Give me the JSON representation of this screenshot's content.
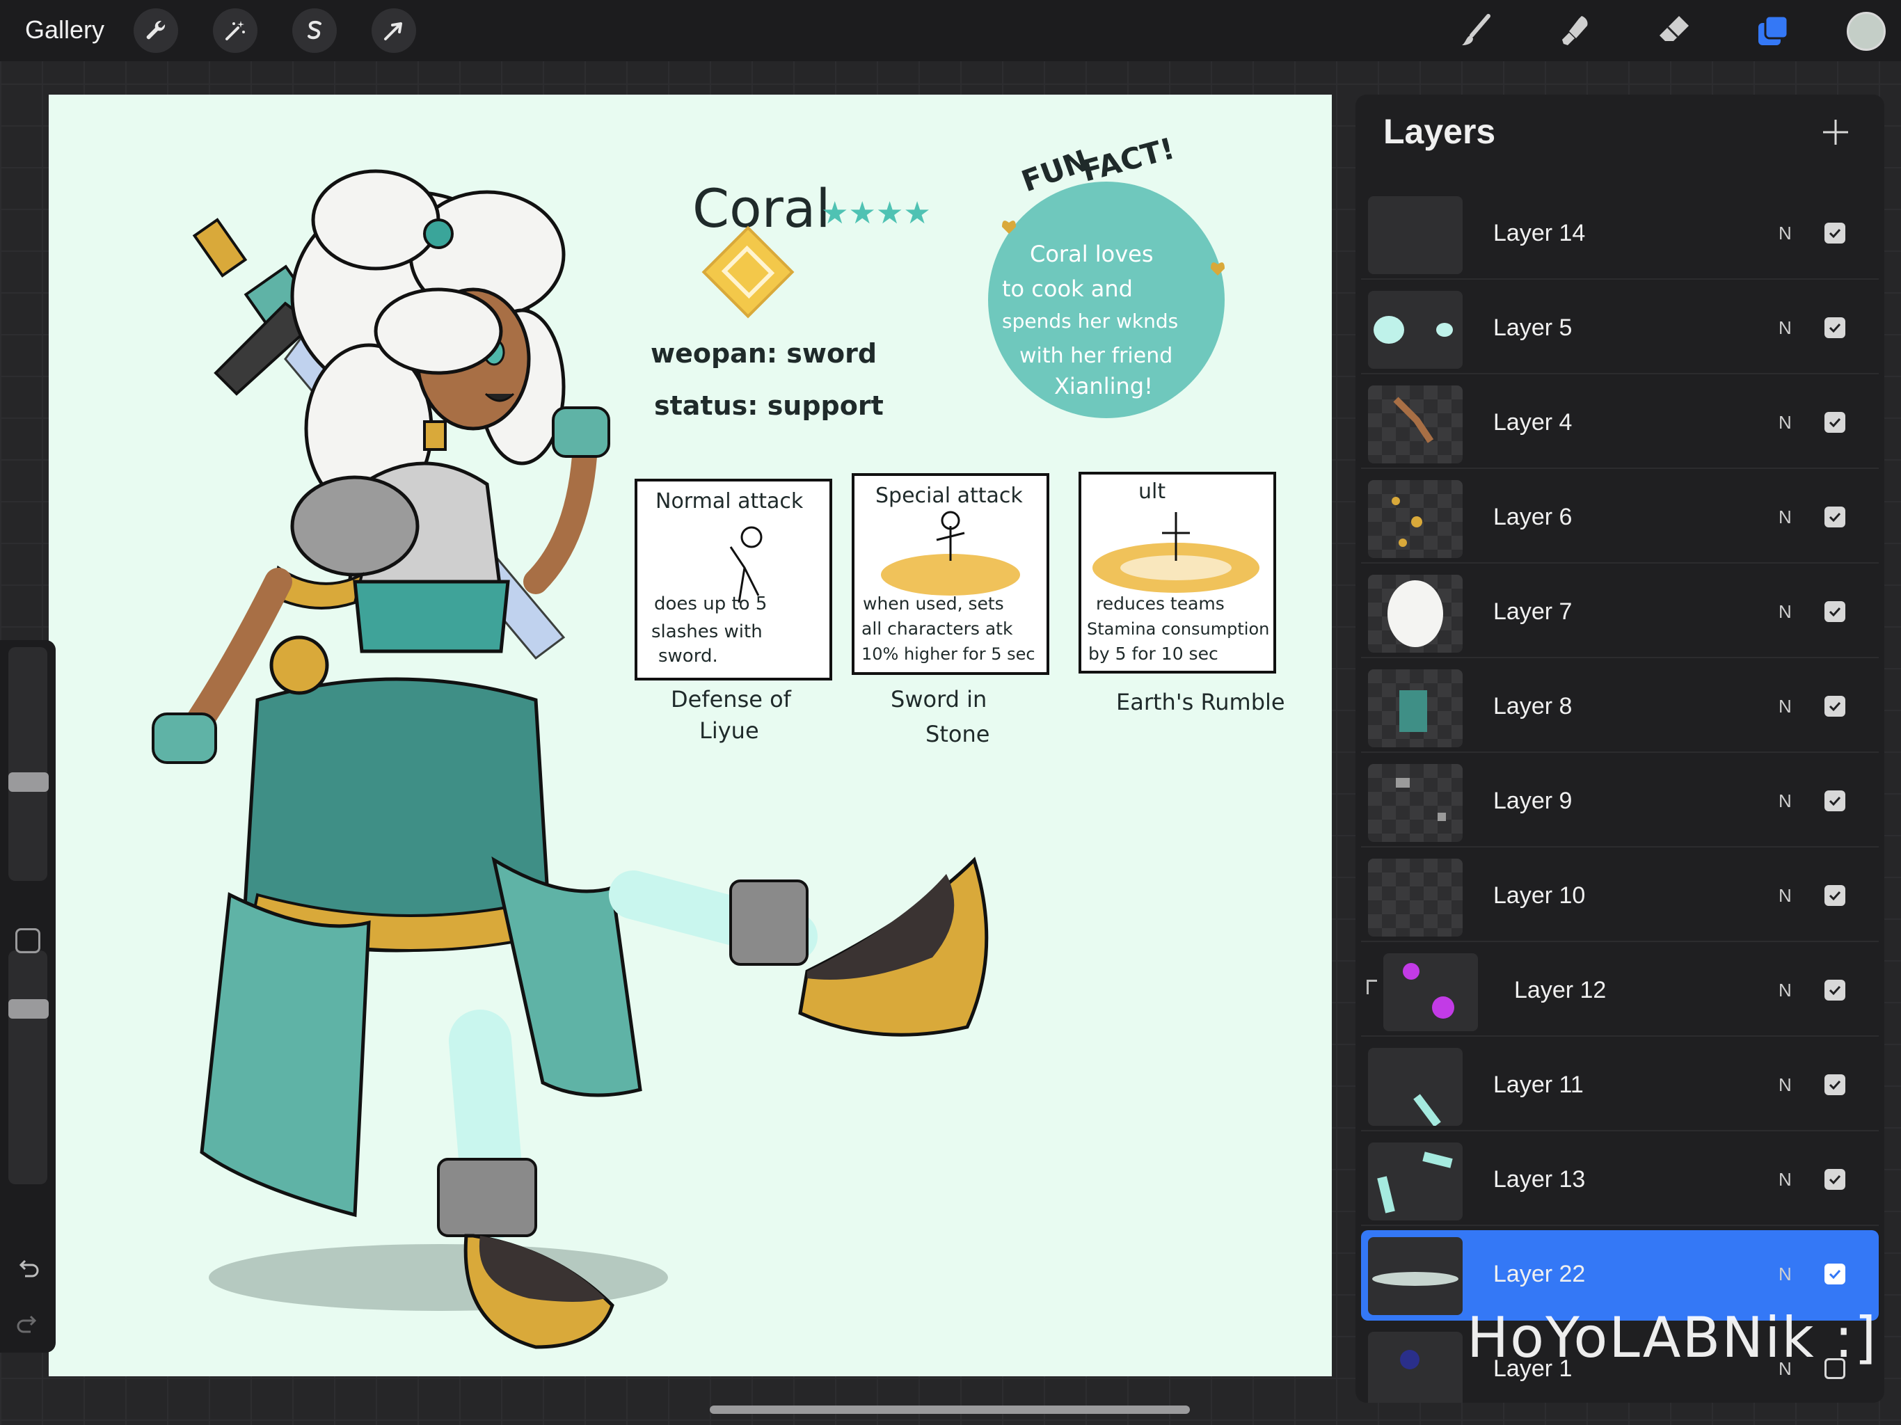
{
  "topbar": {
    "gallery_label": "Gallery",
    "tools_left": [
      "wrench-icon",
      "magic-wand-icon",
      "selection-icon",
      "transform-arrow-icon"
    ],
    "tools_right": [
      "brush-icon",
      "smudge-icon",
      "eraser-icon",
      "layers-icon",
      "color-swatch"
    ],
    "current_color": "#c4cec7",
    "accent": "#3478f6"
  },
  "canvas": {
    "name": "Coral",
    "stars": "★★★★",
    "weapon_line": "weopan:  sword",
    "status_line": "status:  support",
    "fun_fact_title_1": "FUN",
    "fun_fact_title_2": "FACT!",
    "fun_fact_lines": [
      "Coral  loves",
      "to  cook  and",
      "spends  her  wknds",
      "with  her friend",
      "Xianling!"
    ],
    "panels": [
      {
        "title": "Normal  attack",
        "desc": [
          "does  up  to  5",
          "slashes  with",
          "sword."
        ],
        "caption": [
          "Defense  of",
          "Liyue"
        ]
      },
      {
        "title": "Special attack",
        "desc": [
          "when  used, sets",
          "all  characters  atk",
          "10%  higher  for  5 sec"
        ],
        "caption": [
          "Sword   in",
          "Stone"
        ]
      },
      {
        "title": "ult",
        "desc": [
          "reduces  teams",
          "Stamina  consumption",
          "by  5  for  10  sec"
        ],
        "caption": [
          "Earth's Rumble"
        ]
      }
    ]
  },
  "layers": {
    "title": "Layers",
    "items": [
      {
        "name": "Layer 14",
        "blend": "N",
        "visible": true
      },
      {
        "name": "Layer 5",
        "blend": "N",
        "visible": true
      },
      {
        "name": "Layer 4",
        "blend": "N",
        "visible": true
      },
      {
        "name": "Layer 6",
        "blend": "N",
        "visible": true
      },
      {
        "name": "Layer 7",
        "blend": "N",
        "visible": true
      },
      {
        "name": "Layer 8",
        "blend": "N",
        "visible": true
      },
      {
        "name": "Layer 9",
        "blend": "N",
        "visible": true
      },
      {
        "name": "Layer 10",
        "blend": "N",
        "visible": true
      },
      {
        "name": "Layer 12",
        "blend": "N",
        "visible": true,
        "clipped": true
      },
      {
        "name": "Layer 11",
        "blend": "N",
        "visible": true
      },
      {
        "name": "Layer 13",
        "blend": "N",
        "visible": true
      },
      {
        "name": "Layer 22",
        "blend": "N",
        "visible": true,
        "selected": true
      },
      {
        "name": "Layer 1",
        "blend": "N",
        "visible": false
      }
    ]
  },
  "watermark": "HoYoLABNik :]"
}
